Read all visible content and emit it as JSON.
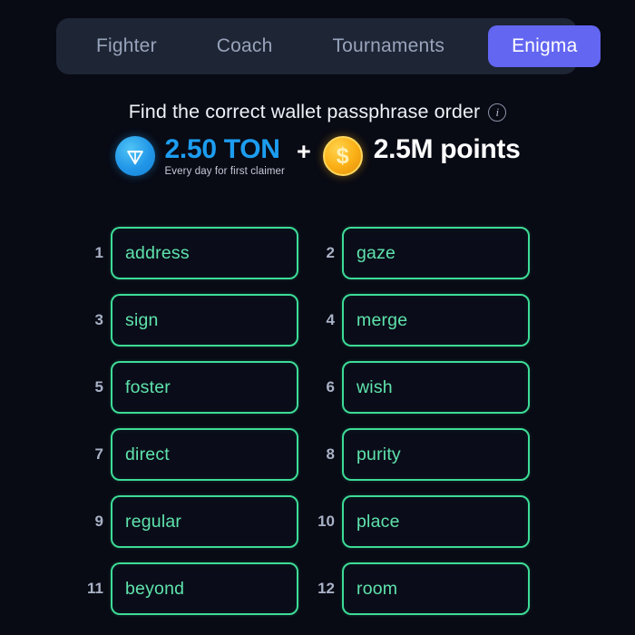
{
  "tabs": [
    {
      "label": "Fighter",
      "active": false
    },
    {
      "label": "Coach",
      "active": false
    },
    {
      "label": "Tournaments",
      "active": false
    },
    {
      "label": "Enigma",
      "active": true
    }
  ],
  "header": {
    "title": "Find the correct wallet passphrase order",
    "info_icon": "info-icon",
    "info_glyph": "i"
  },
  "reward": {
    "ton_icon": "ton-coin-icon",
    "ton_amount": "2.50 TON",
    "ton_subtitle": "Every day for first claimer",
    "separator": "+",
    "coin_icon": "dollar-coin-icon",
    "coin_glyph": "$",
    "points_amount": "2.5M points"
  },
  "colors": {
    "page_background": "#080a14",
    "tabbar_background": "#1e2535",
    "active_tab": "#6366f1",
    "word_border": "#3ddc97",
    "word_text": "#5fe3ac",
    "ton_blue": "#1c9df0",
    "coin_gold": "#fbb016",
    "index_text": "#a8b2c6"
  },
  "words": [
    {
      "index": "1",
      "word": "address"
    },
    {
      "index": "2",
      "word": "gaze"
    },
    {
      "index": "3",
      "word": "sign"
    },
    {
      "index": "4",
      "word": "merge"
    },
    {
      "index": "5",
      "word": "foster"
    },
    {
      "index": "6",
      "word": "wish"
    },
    {
      "index": "7",
      "word": "direct"
    },
    {
      "index": "8",
      "word": "purity"
    },
    {
      "index": "9",
      "word": "regular"
    },
    {
      "index": "10",
      "word": "place"
    },
    {
      "index": "11",
      "word": "beyond"
    },
    {
      "index": "12",
      "word": "room"
    }
  ]
}
